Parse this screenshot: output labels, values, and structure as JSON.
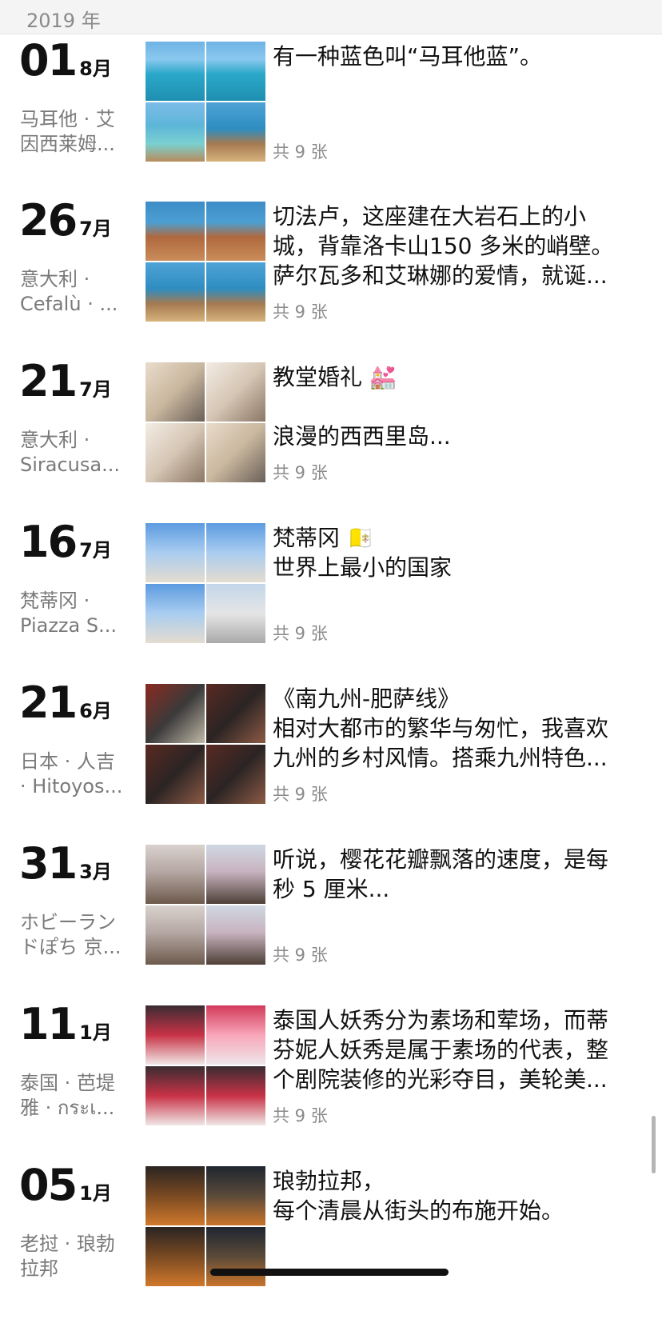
{
  "header": {
    "year": "2019 年"
  },
  "photo_count_prefix": "共 9 张",
  "entries": [
    {
      "day": "01",
      "month": "8月",
      "location": "马耳他 · 艾\n因西莱姆...",
      "text": "有一种蓝色叫“马耳他蓝”。",
      "count": "共 9 张",
      "photos": [
        "c-sea1",
        "c-sea1",
        "c-sea2",
        "c-sea3"
      ]
    },
    {
      "day": "26",
      "month": "7月",
      "location": "意大利 ·\nCefalù · ...",
      "text": "切法卢，这座建在大岩石上的小\n城，背靠洛卡山150 多米的峭壁。\n萨尔瓦多和艾琳娜的爱情，就诞...",
      "count": "共 9 张",
      "photos": [
        "c-town",
        "c-town",
        "c-sea3",
        "c-sea3"
      ]
    },
    {
      "day": "21",
      "month": "7月",
      "location": "意大利 ·\nSiracusa...",
      "text": "教堂婚礼 💒\n\n浪漫的西西里岛...",
      "count": "共 9 张",
      "photos": [
        "c-church1",
        "c-church2",
        "c-church2",
        "c-church1"
      ]
    },
    {
      "day": "16",
      "month": "7月",
      "location": "梵蒂冈 ·\nPiazza S...",
      "text": "梵蒂冈 🇻🇦\n世界上最小的国家",
      "count": "共 9 张",
      "photos": [
        "c-sky",
        "c-sky",
        "c-sky",
        "c-statue"
      ]
    },
    {
      "day": "21",
      "month": "6月",
      "location": "日本 · 人吉\n· Hitoyos...",
      "text": "《南九州-肥萨线》\n相对大都市的繁华与匆忙，我喜欢\n九州的乡村风情。搭乘九州特色...",
      "count": "共 9 张",
      "photos": [
        "c-train1",
        "c-train2",
        "c-train2",
        "c-train2"
      ]
    },
    {
      "day": "31",
      "month": "3月",
      "location": "ホビーラン\nドぽち 京...",
      "text": "听说，樱花花瓣飘落的速度，是每\n秒 5 厘米...",
      "count": "共 9 张",
      "photos": [
        "c-blossom1",
        "c-blossom2",
        "c-blossom1",
        "c-blossom2"
      ]
    },
    {
      "day": "11",
      "month": "1月",
      "location": "泰国 · 芭堤\n雅 · กระเ...",
      "text": "泰国人妖秀分为素场和荤场，而蒂\n芬妮人妖秀是属于素场的代表，整\n个剧院装修的光彩夺目，美轮美...",
      "count": "共 9 张",
      "photos": [
        "c-show1",
        "c-show2",
        "c-show1",
        "c-show1"
      ]
    },
    {
      "day": "05",
      "month": "1月",
      "location": "老挝 · 琅勃\n拉邦",
      "text": "琅勃拉邦，\n每个清晨从街头的布施开始。",
      "count": "共 9 张",
      "photos": [
        "c-monk1",
        "c-monk2",
        "c-monk1",
        "c-monk2"
      ]
    }
  ]
}
